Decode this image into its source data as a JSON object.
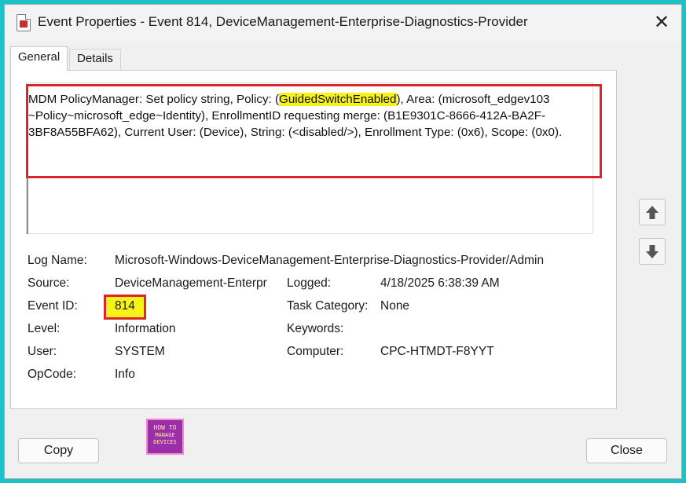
{
  "window": {
    "title": "Event Properties - Event 814, DeviceManagement-Enterprise-Diagnostics-Provider",
    "close_symbol": "✕"
  },
  "tabs": [
    {
      "label": "General",
      "selected": true
    },
    {
      "label": "Details",
      "selected": false
    }
  ],
  "description": {
    "prefix": "MDM PolicyManager: Set policy string, Policy: (",
    "highlight": "GuidedSwitchEnabled",
    "suffix": "), Area: (microsoft_edgev103 ~Policy~microsoft_edge~Identity), EnrollmentID requesting merge: (B1E9301C-8666-412A-BA2F-3BF8A55BFA62), Current User: (Device), String: (<disabled/>), Enrollment Type: (0x6), Scope: (0x0)."
  },
  "fields": {
    "log_name": {
      "label": "Log Name:",
      "value": "Microsoft-Windows-DeviceManagement-Enterprise-Diagnostics-Provider/Admin"
    },
    "source": {
      "label": "Source:",
      "value": "DeviceManagement-Enterpr"
    },
    "logged": {
      "label": "Logged:",
      "value": "4/18/2025 6:38:39 AM"
    },
    "event_id": {
      "label": "Event ID:",
      "value": "814"
    },
    "task_category": {
      "label": "Task Category:",
      "value": "None"
    },
    "level": {
      "label": "Level:",
      "value": "Information"
    },
    "keywords": {
      "label": "Keywords:",
      "value": ""
    },
    "user": {
      "label": "User:",
      "value": "SYSTEM"
    },
    "computer": {
      "label": "Computer:",
      "value": "CPC-HTMDT-F8YYT"
    },
    "opcode": {
      "label": "OpCode:",
      "value": "Info"
    }
  },
  "buttons": {
    "copy": "Copy",
    "close": "Close"
  },
  "logo": {
    "line1": "HOW TO",
    "line2": "MANAGE",
    "line3": "DEVICES"
  },
  "colors": {
    "highlight": "#f7f21a",
    "annotation_red": "#d9252b",
    "background_teal": "#1fc1c8"
  }
}
